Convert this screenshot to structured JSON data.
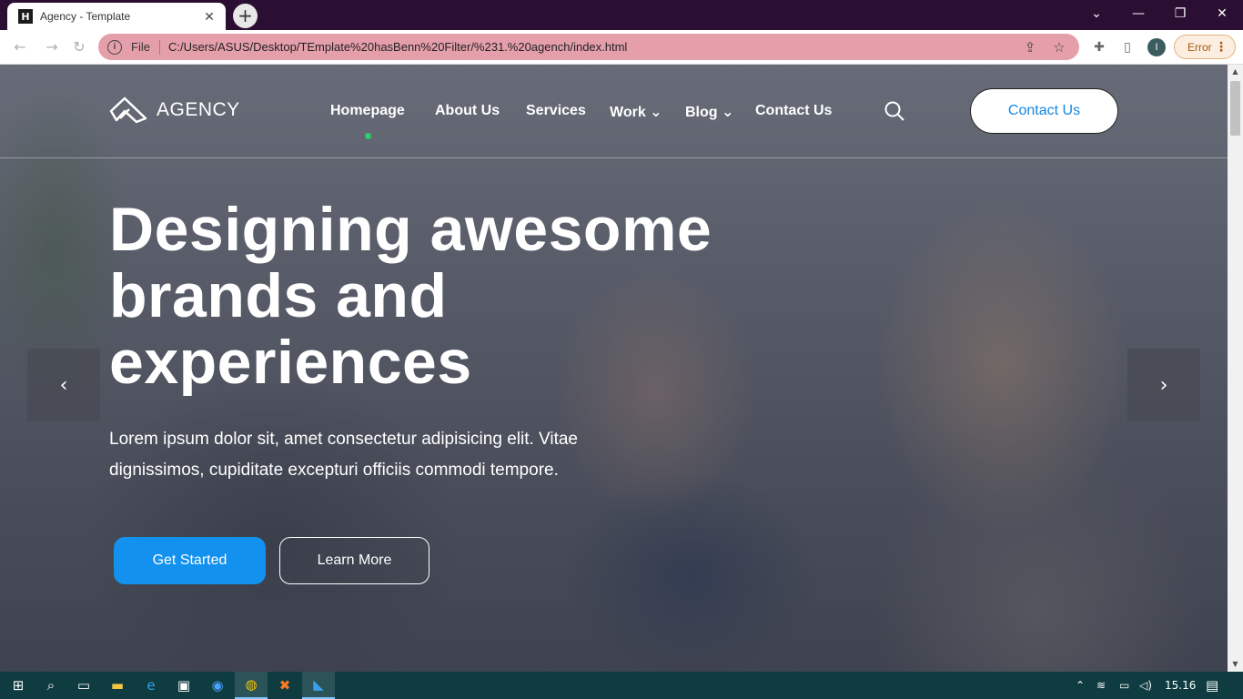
{
  "browser": {
    "tab_title": "Agency - Template",
    "tab_favicon": "H",
    "tab_close": "✕",
    "new_tab": "+",
    "window_controls": {
      "dropdown": "⌄",
      "minimize": "—",
      "restore": "❐",
      "close": "✕"
    },
    "address": {
      "scheme_label": "File",
      "url": "C:/Users/ASUS/Desktop/TEmplate%20hasBenn%20Filter/%231.%20agench/index.html"
    },
    "profile_initial": "I",
    "error_label": "Error",
    "error_menu": "⋮",
    "accent_color": "#e59fab"
  },
  "site": {
    "logo_text": "AGENCY",
    "nav": [
      {
        "label": "Homepage",
        "active": true
      },
      {
        "label": "About Us"
      },
      {
        "label": "Services"
      },
      {
        "label": "Work ⌄"
      },
      {
        "label": "Blog ⌄"
      },
      {
        "label": "Contact Us"
      }
    ],
    "header_cta": "Contact Us",
    "hero": {
      "headline_line1": "Designing awesome",
      "headline_line2": "brands and",
      "headline_line3": "experiences",
      "subtext_line1": "Lorem ipsum dolor sit, amet consectetur adipisicing elit. Vitae",
      "subtext_line2": "dignissimos, cupiditate excepturi officiis commodi tempore.",
      "primary_button": "Get Started",
      "secondary_button": "Learn More",
      "prev_arrow": "‹",
      "next_arrow": "›"
    },
    "colors": {
      "primary": "#1291ee",
      "active_dot": "#2ecc71",
      "cta_text": "#1787e0"
    }
  },
  "taskbar": {
    "clock": "15.16",
    "icons": [
      "windows-start-icon",
      "search-icon",
      "task-view-icon",
      "file-explorer-icon",
      "edge-icon",
      "store-icon",
      "zoom-icon",
      "chrome-icon",
      "xampp-icon",
      "vscode-icon"
    ]
  }
}
